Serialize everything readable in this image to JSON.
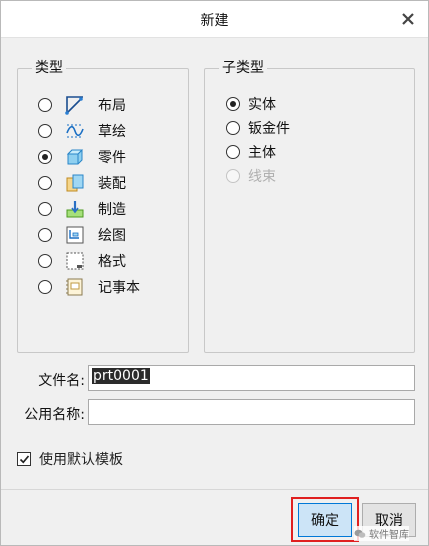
{
  "dialog": {
    "title": "新建",
    "close_icon": "close-icon"
  },
  "type_group": {
    "legend": "类型",
    "items": [
      {
        "label": "布局",
        "icon": "layout-icon",
        "selected": false
      },
      {
        "label": "草绘",
        "icon": "sketch-icon",
        "selected": false
      },
      {
        "label": "零件",
        "icon": "part-icon",
        "selected": true
      },
      {
        "label": "装配",
        "icon": "assembly-icon",
        "selected": false
      },
      {
        "label": "制造",
        "icon": "manufacturing-icon",
        "selected": false
      },
      {
        "label": "绘图",
        "icon": "drawing-icon",
        "selected": false
      },
      {
        "label": "格式",
        "icon": "format-icon",
        "selected": false
      },
      {
        "label": "记事本",
        "icon": "notebook-icon",
        "selected": false
      }
    ]
  },
  "subtype_group": {
    "legend": "子类型",
    "items": [
      {
        "label": "实体",
        "selected": true,
        "disabled": false
      },
      {
        "label": "钣金件",
        "selected": false,
        "disabled": false
      },
      {
        "label": "主体",
        "selected": false,
        "disabled": false
      },
      {
        "label": "线束",
        "selected": false,
        "disabled": true
      }
    ]
  },
  "fields": {
    "filename_label": "文件名:",
    "filename_value": "prt0001",
    "common_name_label": "公用名称:",
    "common_name_value": ""
  },
  "template_checkbox": {
    "label": "使用默认模板",
    "checked": true
  },
  "buttons": {
    "ok_label": "确定",
    "cancel_label": "取消"
  },
  "watermark": {
    "text": "软件智库"
  },
  "colors": {
    "ok_button_bg": "#cce4f7",
    "ok_button_border": "#0078d7",
    "highlight_border": "#e02020",
    "selection_bg": "#2b2b2b"
  }
}
